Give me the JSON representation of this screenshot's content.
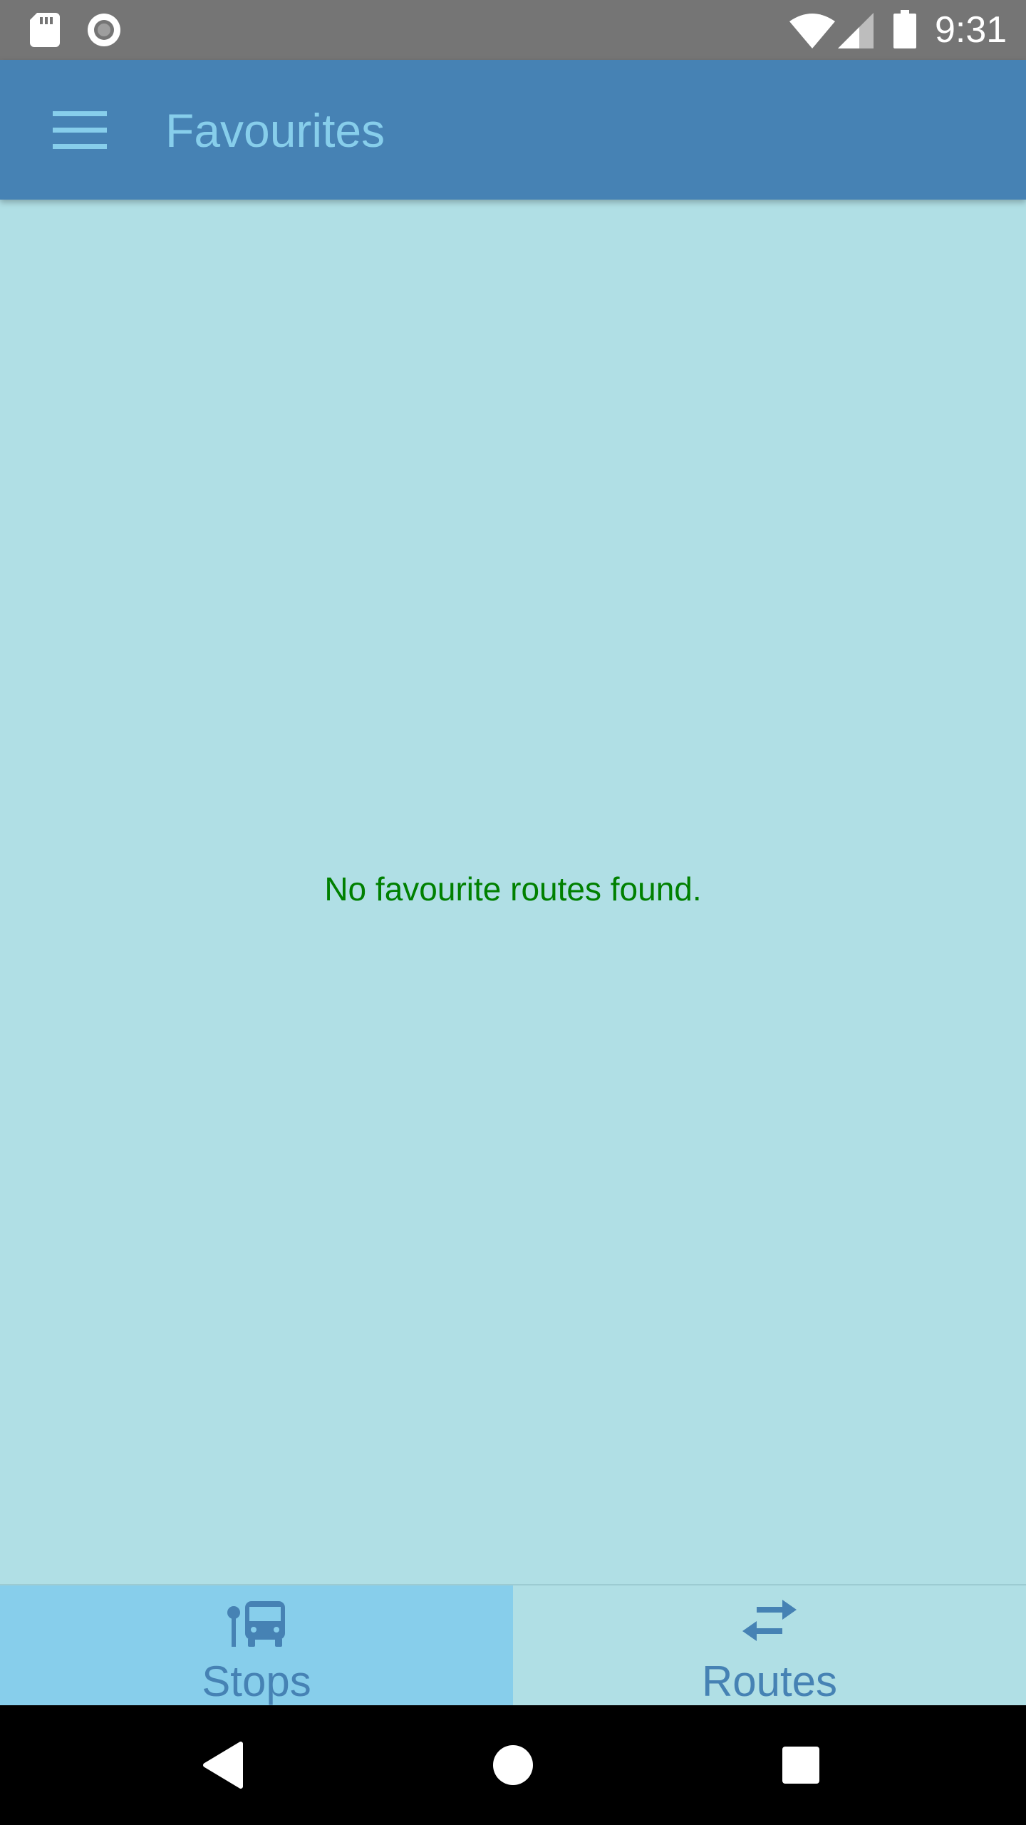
{
  "status_bar": {
    "time": "9:31",
    "icons": [
      "sd-card-icon",
      "record-icon",
      "wifi-icon",
      "cell-signal-icon",
      "battery-icon"
    ]
  },
  "app_bar": {
    "title": "Favourites",
    "menu_icon": "hamburger-menu-icon"
  },
  "content": {
    "empty_message": "No favourite routes found."
  },
  "bottom_nav": {
    "tabs": [
      {
        "label": "Stops",
        "icon": "bus-stop-icon",
        "selected": true
      },
      {
        "label": "Routes",
        "icon": "swap-arrows-icon",
        "selected": false
      }
    ]
  },
  "system_nav": {
    "buttons": [
      "back-icon",
      "home-icon",
      "recents-icon"
    ]
  },
  "colors": {
    "status_bar": "#757575",
    "app_bar": "#4682B4",
    "title": "#87CEEB",
    "background": "#B0DFE5",
    "empty_message": "#008000",
    "selected_tab": "#87CEEB",
    "tab_label": "#4682B4",
    "system_nav": "#000000"
  }
}
